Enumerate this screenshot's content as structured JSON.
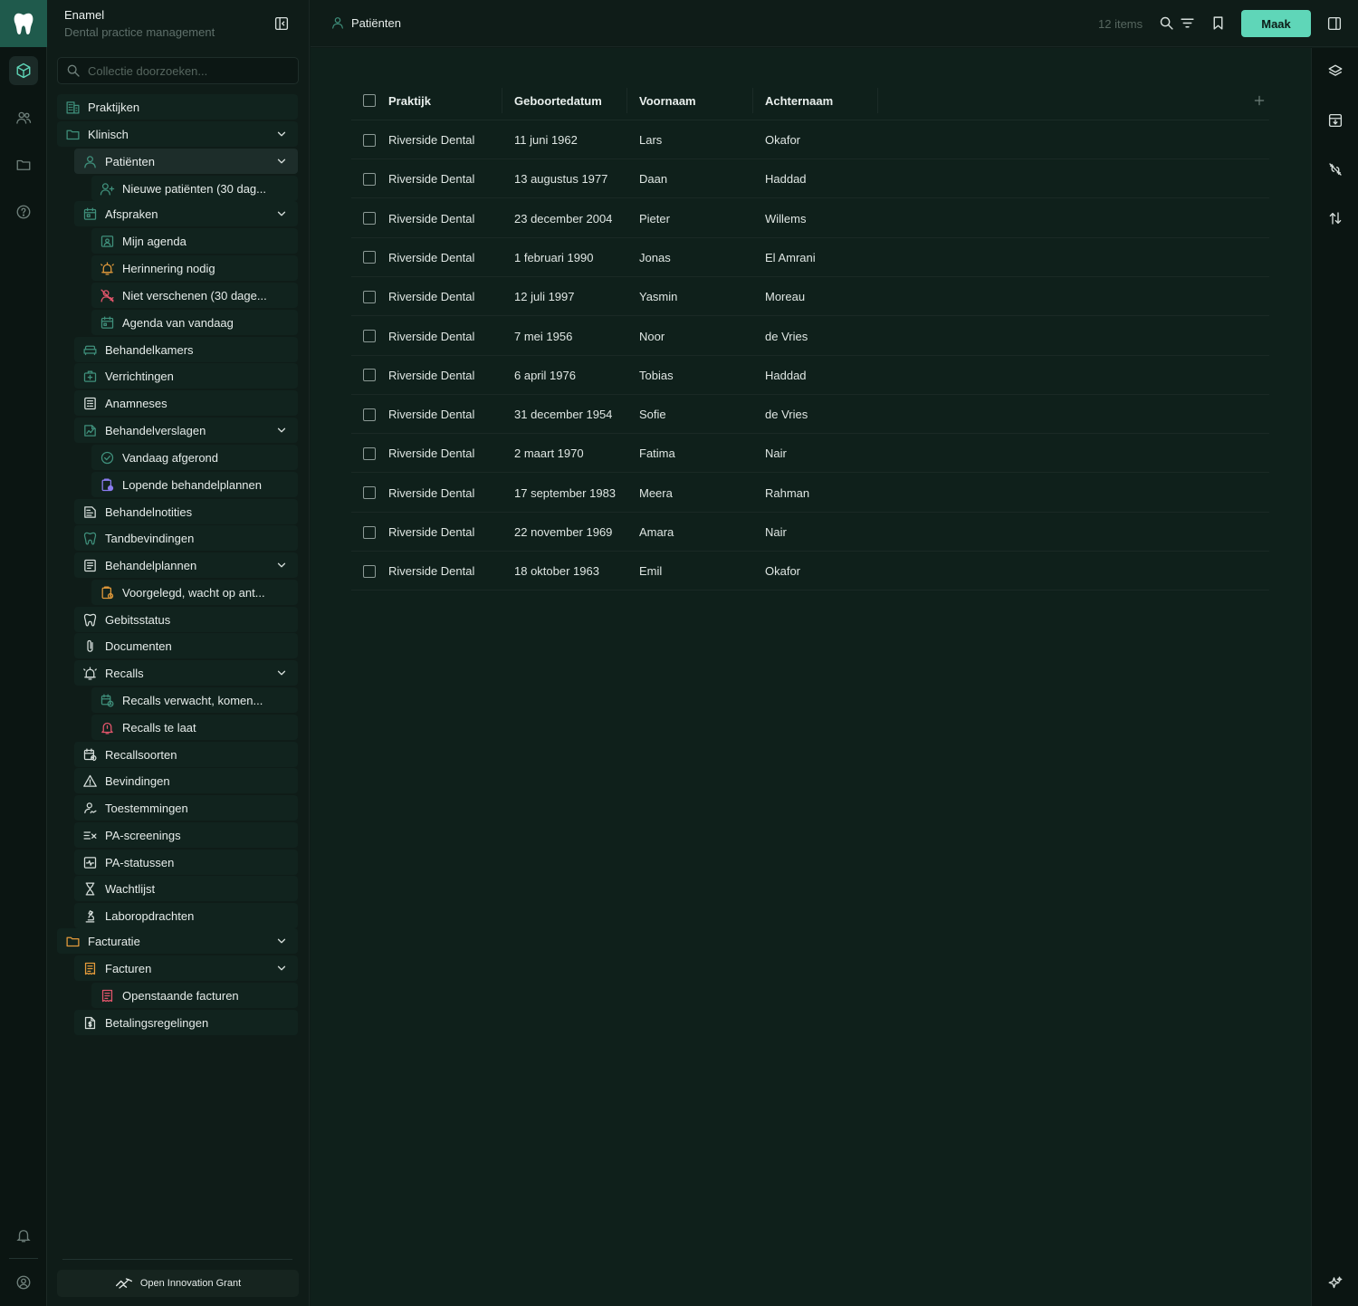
{
  "app": {
    "name": "Enamel",
    "subtitle": "Dental practice management"
  },
  "sidebar": {
    "search_placeholder": "Collectie doorzoeken...",
    "footer_button": "Open Innovation Grant",
    "items": [
      {
        "label": "Praktijken",
        "icon": "building-icon",
        "color": "#3f8f7b",
        "level": 0,
        "chevron": false,
        "selected": false
      },
      {
        "label": "Klinisch",
        "icon": "folder-icon",
        "color": "#3f8f7b",
        "level": 0,
        "chevron": true,
        "selected": false
      },
      {
        "label": "Patiënten",
        "icon": "user-icon",
        "color": "#3f8f7b",
        "level": 1,
        "chevron": true,
        "selected": true
      },
      {
        "label": "Nieuwe patiënten (30 dag...",
        "icon": "user-plus-icon",
        "color": "#3f8f7b",
        "level": 2,
        "chevron": false,
        "selected": false
      },
      {
        "label": "Afspraken",
        "icon": "calendar-icon",
        "color": "#3f8f7b",
        "level": 1,
        "chevron": true,
        "selected": false
      },
      {
        "label": "Mijn agenda",
        "icon": "calendar-user-icon",
        "color": "#3f8f7b",
        "level": 2,
        "chevron": false,
        "selected": false
      },
      {
        "label": "Herinnering nodig",
        "icon": "alarm-icon",
        "color": "#e39a3b",
        "level": 2,
        "chevron": false,
        "selected": false
      },
      {
        "label": "Niet verschenen (30 dage...",
        "icon": "user-x-icon",
        "color": "#e2556b",
        "level": 2,
        "chevron": false,
        "selected": false
      },
      {
        "label": "Agenda van vandaag",
        "icon": "calendar-today-icon",
        "color": "#3f8f7b",
        "level": 2,
        "chevron": false,
        "selected": false
      },
      {
        "label": "Behandelkamers",
        "icon": "sofa-icon",
        "color": "#3f8f7b",
        "level": 1,
        "chevron": false,
        "selected": false
      },
      {
        "label": "Verrichtingen",
        "icon": "medical-box-icon",
        "color": "#3f8f7b",
        "level": 1,
        "chevron": false,
        "selected": false
      },
      {
        "label": "Anamneses",
        "icon": "clipboard-list-icon",
        "color": "#d6dedb",
        "level": 1,
        "chevron": false,
        "selected": false
      },
      {
        "label": "Behandelverslagen",
        "icon": "report-icon",
        "color": "#3f8f7b",
        "level": 1,
        "chevron": true,
        "selected": false
      },
      {
        "label": "Vandaag afgerond",
        "icon": "check-circle-icon",
        "color": "#3f8f7b",
        "level": 2,
        "chevron": false,
        "selected": false
      },
      {
        "label": "Lopende behandelplannen",
        "icon": "clipboard-progress-icon",
        "color": "#8b7cf0",
        "level": 2,
        "chevron": false,
        "selected": false
      },
      {
        "label": "Behandelnotities",
        "icon": "notes-icon",
        "color": "#d6dedb",
        "level": 1,
        "chevron": false,
        "selected": false
      },
      {
        "label": "Tandbevindingen",
        "icon": "tooth-icon",
        "color": "#3f8f7b",
        "level": 1,
        "chevron": false,
        "selected": false
      },
      {
        "label": "Behandelplannen",
        "icon": "plan-icon",
        "color": "#d6dedb",
        "level": 1,
        "chevron": true,
        "selected": false
      },
      {
        "label": "Voorgelegd, wacht op ant...",
        "icon": "clipboard-clock-icon",
        "color": "#e39a3b",
        "level": 2,
        "chevron": false,
        "selected": false
      },
      {
        "label": "Gebitsstatus",
        "icon": "tooth-icon",
        "color": "#d6dedb",
        "level": 1,
        "chevron": false,
        "selected": false
      },
      {
        "label": "Documenten",
        "icon": "paperclip-icon",
        "color": "#d6dedb",
        "level": 1,
        "chevron": false,
        "selected": false
      },
      {
        "label": "Recalls",
        "icon": "alarm-icon",
        "color": "#d6dedb",
        "level": 1,
        "chevron": true,
        "selected": false
      },
      {
        "label": "Recalls verwacht, komen...",
        "icon": "calendar-clock-icon",
        "color": "#3f8f7b",
        "level": 2,
        "chevron": false,
        "selected": false
      },
      {
        "label": "Recalls te laat",
        "icon": "bell-alert-icon",
        "color": "#e2556b",
        "level": 2,
        "chevron": false,
        "selected": false
      },
      {
        "label": "Recallsoorten",
        "icon": "calendar-repeat-icon",
        "color": "#d6dedb",
        "level": 1,
        "chevron": false,
        "selected": false
      },
      {
        "label": "Bevindingen",
        "icon": "warning-icon",
        "color": "#d6dedb",
        "level": 1,
        "chevron": false,
        "selected": false
      },
      {
        "label": "Toestemmingen",
        "icon": "user-sign-icon",
        "color": "#d6dedb",
        "level": 1,
        "chevron": false,
        "selected": false
      },
      {
        "label": "PA-screenings",
        "icon": "list-x-icon",
        "color": "#d6dedb",
        "level": 1,
        "chevron": false,
        "selected": false
      },
      {
        "label": "PA-statussen",
        "icon": "activity-icon",
        "color": "#d6dedb",
        "level": 1,
        "chevron": false,
        "selected": false
      },
      {
        "label": "Wachtlijst",
        "icon": "hourglass-icon",
        "color": "#d6dedb",
        "level": 1,
        "chevron": false,
        "selected": false
      },
      {
        "label": "Laboropdrachten",
        "icon": "microscope-icon",
        "color": "#d6dedb",
        "level": 1,
        "chevron": false,
        "selected": false
      },
      {
        "label": "Facturatie",
        "icon": "folder-icon",
        "color": "#e39a3b",
        "level": 0,
        "chevron": true,
        "selected": false
      },
      {
        "label": "Facturen",
        "icon": "receipt-icon",
        "color": "#e39a3b",
        "level": 1,
        "chevron": true,
        "selected": false
      },
      {
        "label": "Openstaande facturen",
        "icon": "receipt-icon",
        "color": "#e2556b",
        "level": 2,
        "chevron": false,
        "selected": false
      },
      {
        "label": "Betalingsregelingen",
        "icon": "file-dollar-icon",
        "color": "#d6dedb",
        "level": 1,
        "chevron": false,
        "selected": false
      }
    ]
  },
  "topbar": {
    "breadcrumb": "Patiënten",
    "count": "12 items",
    "create_button": "Maak"
  },
  "table": {
    "columns": [
      "Praktijk",
      "Geboortedatum",
      "Voornaam",
      "Achternaam"
    ],
    "rows": [
      [
        "Riverside Dental",
        "11 juni 1962",
        "Lars",
        "Okafor"
      ],
      [
        "Riverside Dental",
        "13 augustus 1977",
        "Daan",
        "Haddad"
      ],
      [
        "Riverside Dental",
        "23 december 2004",
        "Pieter",
        "Willems"
      ],
      [
        "Riverside Dental",
        "1 februari 1990",
        "Jonas",
        "El Amrani"
      ],
      [
        "Riverside Dental",
        "12 juli 1997",
        "Yasmin",
        "Moreau"
      ],
      [
        "Riverside Dental",
        "7 mei 1956",
        "Noor",
        "de Vries"
      ],
      [
        "Riverside Dental",
        "6 april 1976",
        "Tobias",
        "Haddad"
      ],
      [
        "Riverside Dental",
        "31 december 1954",
        "Sofie",
        "de Vries"
      ],
      [
        "Riverside Dental",
        "2 maart 1970",
        "Fatima",
        "Nair"
      ],
      [
        "Riverside Dental",
        "17 september 1983",
        "Meera",
        "Rahman"
      ],
      [
        "Riverside Dental",
        "22 november 1969",
        "Amara",
        "Nair"
      ],
      [
        "Riverside Dental",
        "18 oktober 1963",
        "Emil",
        "Okafor"
      ]
    ]
  },
  "colors": {
    "accent": "#5fd6b8",
    "brand_tile": "#1f5a4c",
    "background": "#0f1c18",
    "warning": "#e39a3b",
    "danger": "#e2556b",
    "purple": "#8b7cf0"
  }
}
